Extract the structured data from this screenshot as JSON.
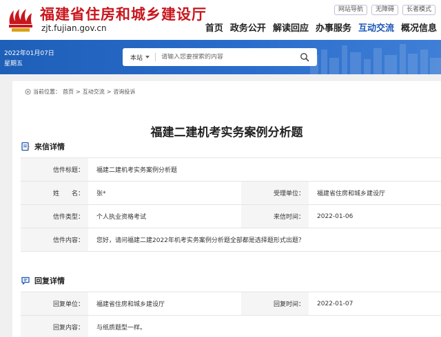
{
  "site": {
    "name": "福建省住房和城乡建设厅",
    "url": "zjt.fujian.gov.cn"
  },
  "quick_links": [
    "网站导航",
    "无障碍",
    "长者模式"
  ],
  "nav": [
    {
      "label": "首页",
      "active": false
    },
    {
      "label": "政务公开",
      "active": false
    },
    {
      "label": "解读回应",
      "active": false
    },
    {
      "label": "办事服务",
      "active": false
    },
    {
      "label": "互动交流",
      "active": true
    },
    {
      "label": "概况信息",
      "active": false
    }
  ],
  "banner": {
    "date": "2022年01月07日",
    "weekday": "星期五",
    "search_scope": "本站",
    "search_placeholder": "请输入您要搜索的内容"
  },
  "breadcrumb": {
    "prefix": "当前位置：",
    "items": [
      "首页",
      "互动交流",
      "咨询投诉"
    ],
    "separator": ">"
  },
  "page_title": "福建二建机考实务案例分析题",
  "letter_section": {
    "title": "来信详情",
    "subject_label": "信件标题：",
    "subject_value": "福建二建机考实务案例分析题",
    "name_label": "姓　　名：",
    "name_value": "张*",
    "dept_label": "受理单位：",
    "dept_value": "福建省住房和城乡建设厅",
    "type_label": "信件类型：",
    "type_value": "个人执业资格考试",
    "date_label": "来信时间：",
    "date_value": "2022-01-06",
    "content_label": "信件内容：",
    "content_value": "您好，请问福建二建2022年机考实务案例分析题全部都是选择题形式出题？"
  },
  "reply_section": {
    "title": "回复详情",
    "unit_label": "回复单位：",
    "unit_value": "福建省住房和城乡建设厅",
    "date_label": "回复时间：",
    "date_value": "2022-01-07",
    "content_label": "回复内容：",
    "content_value": "与纸质题型一样。"
  },
  "colors": {
    "brand_red": "#c8161d",
    "nav_active": "#1a56b5",
    "banner_blue": "#2a6ccb"
  }
}
